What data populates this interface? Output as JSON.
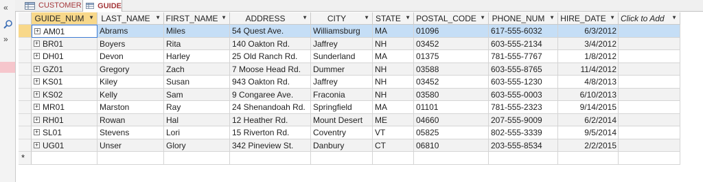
{
  "nav": {
    "collapse_glyph": "«",
    "chevron_glyph": "»",
    "icons": [
      "search-icon"
    ]
  },
  "tabs": [
    {
      "label": "CUSTOMER",
      "active": false,
      "icon": "table-icon"
    },
    {
      "label": "GUIDE",
      "active": true,
      "icon": "table-icon"
    }
  ],
  "columns": [
    {
      "label": "GUIDE_NUM"
    },
    {
      "label": "LAST_NAME"
    },
    {
      "label": "FIRST_NAME"
    },
    {
      "label": "ADDRESS"
    },
    {
      "label": "CITY"
    },
    {
      "label": "STATE"
    },
    {
      "label": "POSTAL_CODE"
    },
    {
      "label": "PHONE_NUM"
    },
    {
      "label": "HIRE_DATE"
    },
    {
      "label": "Click to Add"
    }
  ],
  "rows": [
    [
      "AM01",
      "Abrams",
      "Miles",
      "54 Quest Ave.",
      "Williamsburg",
      "MA",
      "01096",
      "617-555-6032",
      "6/3/2012"
    ],
    [
      "BR01",
      "Boyers",
      "Rita",
      "140 Oakton Rd.",
      "Jaffrey",
      "NH",
      "03452",
      "603-555-2134",
      "3/4/2012"
    ],
    [
      "DH01",
      "Devon",
      "Harley",
      "25 Old Ranch Rd.",
      "Sunderland",
      "MA",
      "01375",
      "781-555-7767",
      "1/8/2012"
    ],
    [
      "GZ01",
      "Gregory",
      "Zach",
      "7 Moose Head Rd.",
      "Dummer",
      "NH",
      "03588",
      "603-555-8765",
      "11/4/2012"
    ],
    [
      "KS01",
      "Kiley",
      "Susan",
      "943 Oakton Rd.",
      "Jaffrey",
      "NH",
      "03452",
      "603-555-1230",
      "4/8/2013"
    ],
    [
      "KS02",
      "Kelly",
      "Sam",
      "9 Congaree Ave.",
      "Fraconia",
      "NH",
      "03580",
      "603-555-0003",
      "6/10/2013"
    ],
    [
      "MR01",
      "Marston",
      "Ray",
      "24 Shenandoah Rd.",
      "Springfield",
      "MA",
      "01101",
      "781-555-2323",
      "9/14/2015"
    ],
    [
      "RH01",
      "Rowan",
      "Hal",
      "12 Heather Rd.",
      "Mount Desert",
      "ME",
      "04660",
      "207-555-9009",
      "6/2/2014"
    ],
    [
      "SL01",
      "Stevens",
      "Lori",
      "15 Riverton Rd.",
      "Coventry",
      "VT",
      "05825",
      "802-555-3339",
      "9/5/2014"
    ],
    [
      "UG01",
      "Unser",
      "Glory",
      "342 Pineview St.",
      "Danbury",
      "CT",
      "06810",
      "203-555-8534",
      "2/2/2015"
    ]
  ],
  "expander_glyph": "+",
  "new_record_glyph": "*",
  "selected_column": "GUIDE_NUM",
  "current_row": "AM01",
  "colors": {
    "selected_header": "#f8d88a",
    "current_row": "#c5def6",
    "tab_text": "#a4373a"
  }
}
